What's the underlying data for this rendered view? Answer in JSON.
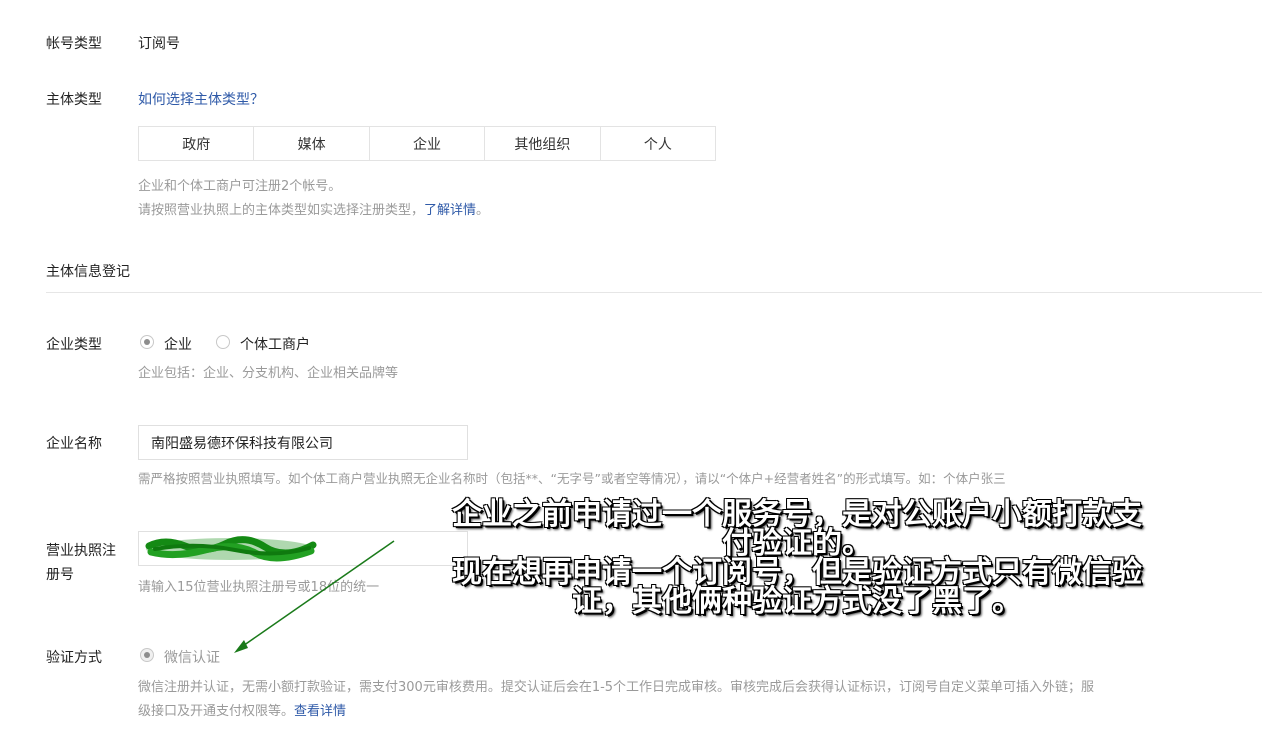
{
  "account_type": {
    "label": "帐号类型",
    "value": "订阅号"
  },
  "entity_type": {
    "label": "主体类型",
    "help_link": "如何选择主体类型？",
    "options": [
      "政府",
      "媒体",
      "企业",
      "其他组织",
      "个人"
    ],
    "hint_line1": "企业和个体工商户可注册2个帐号。",
    "hint_line2": "请按照营业执照上的主体类型如实选择注册类型，",
    "hint_link": "了解详情",
    "hint_end": "。"
  },
  "section": {
    "title": "主体信息登记"
  },
  "enterprise_type": {
    "label": "企业类型",
    "options": [
      "企业",
      "个体工商户"
    ],
    "selected": "企业",
    "hint": "企业包括：企业、分支机构、企业相关品牌等"
  },
  "enterprise_name": {
    "label": "企业名称",
    "value": "南阳盛易德环保科技有限公司",
    "hint": "需严格按照营业执照填写。如个体工商户营业执照无企业名称时（包括**、“无字号”或者空等情况），请以“个体户+经营者姓名”的形式填写。如：个体户张三"
  },
  "license": {
    "label_line1": "营业执照注",
    "label_line2": "册号",
    "hint": "请输入15位营业执照注册号或18位的统一"
  },
  "verify": {
    "label": "验证方式",
    "option": "微信认证",
    "hint_line1": "微信注册并认证，无需小额打款验证，需支付300元审核费用。提交认证后会在1-5个工作日完成审核。审核完成后会获得认证标识，订阅号自定义菜单可插入外链；服",
    "hint_line2": "级接口及开通支付权限等。",
    "hint_link": "查看详情"
  },
  "annotation": {
    "line1": "企业之前申请过一个服务号，是对公账户小额打款支",
    "line2": "付验证的。",
    "line3": "现在想再申请一个订阅号，但是验证方式只有微信验",
    "line4": "证，其他俩种验证方式没了黑了。"
  },
  "colors": {
    "link": "#2f5aa8",
    "hint": "#9a9a9a",
    "scribble": "#1a8f1a",
    "arrow": "#1a7a1a"
  }
}
